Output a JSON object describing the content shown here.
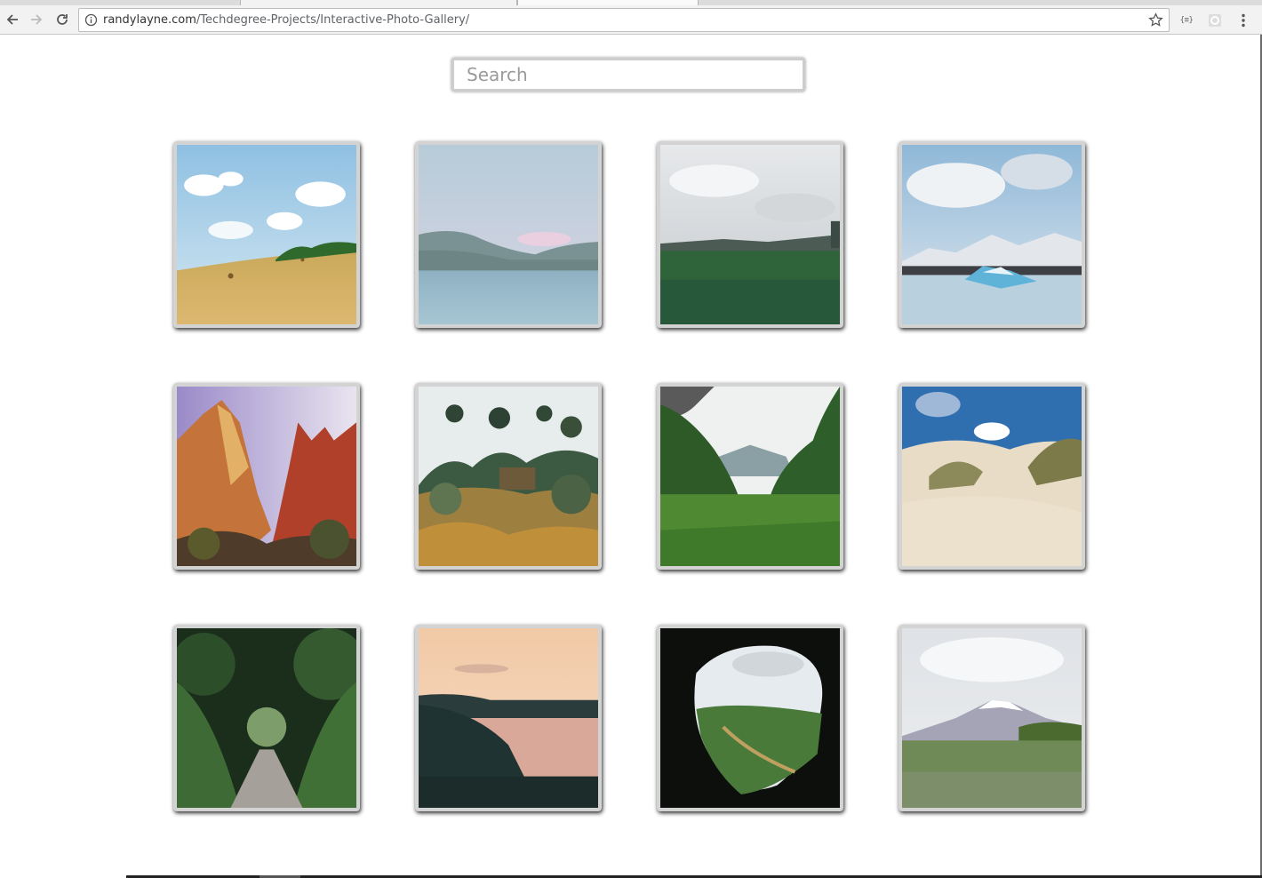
{
  "browser": {
    "url_domain": "randylayne.com",
    "url_path": "/Techdegree-Projects/Interactive-Photo-Gallery/",
    "extension_label": "{≡}"
  },
  "search": {
    "placeholder": "Search",
    "value": ""
  },
  "gallery": {
    "photos": [
      {
        "scene": "hay-field"
      },
      {
        "scene": "mountain-lake"
      },
      {
        "scene": "green-meadow"
      },
      {
        "scene": "glacier-lagoon"
      },
      {
        "scene": "red-canyon"
      },
      {
        "scene": "garden-trees"
      },
      {
        "scene": "jungle-valley"
      },
      {
        "scene": "sand-dunes"
      },
      {
        "scene": "tree-tunnel-path"
      },
      {
        "scene": "sunset-coast"
      },
      {
        "scene": "cave-view"
      },
      {
        "scene": "snowy-mountain-field"
      }
    ]
  }
}
